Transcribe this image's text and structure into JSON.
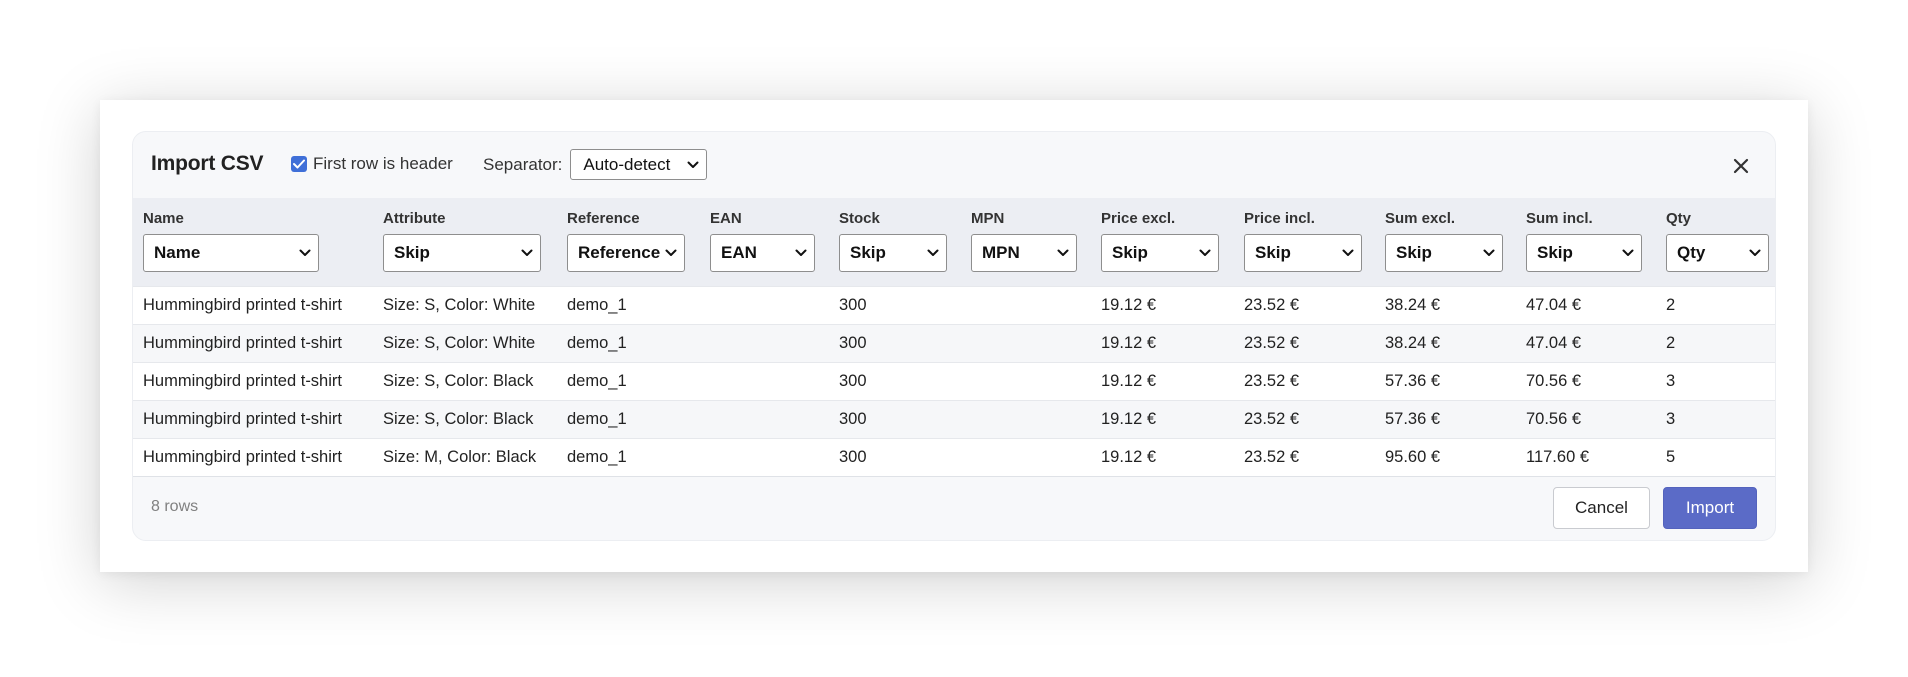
{
  "dialog": {
    "title": "Import CSV",
    "first_row_header_label": "First row is header",
    "first_row_header_checked": true,
    "separator_label": "Separator:",
    "separator_value": "Auto-detect",
    "close_icon": "close-icon"
  },
  "columns": [
    {
      "label": "Name",
      "mapping": "Name"
    },
    {
      "label": "Attribute",
      "mapping": "Skip"
    },
    {
      "label": "Reference",
      "mapping": "Reference"
    },
    {
      "label": "EAN",
      "mapping": "EAN"
    },
    {
      "label": "Stock",
      "mapping": "Skip"
    },
    {
      "label": "MPN",
      "mapping": "MPN"
    },
    {
      "label": "Price excl.",
      "mapping": "Skip"
    },
    {
      "label": "Price incl.",
      "mapping": "Skip"
    },
    {
      "label": "Sum excl.",
      "mapping": "Skip"
    },
    {
      "label": "Sum incl.",
      "mapping": "Skip"
    },
    {
      "label": "Qty",
      "mapping": "Qty"
    }
  ],
  "rows": [
    [
      "Hummingbird printed t-shirt",
      "Size: S, Color: White",
      "demo_1",
      "",
      "300",
      "",
      "19.12 €",
      "23.52 €",
      "38.24 €",
      "47.04 €",
      "2"
    ],
    [
      "Hummingbird printed t-shirt",
      "Size: S, Color: White",
      "demo_1",
      "",
      "300",
      "",
      "19.12 €",
      "23.52 €",
      "38.24 €",
      "47.04 €",
      "2"
    ],
    [
      "Hummingbird printed t-shirt",
      "Size: S, Color: Black",
      "demo_1",
      "",
      "300",
      "",
      "19.12 €",
      "23.52 €",
      "57.36 €",
      "70.56 €",
      "3"
    ],
    [
      "Hummingbird printed t-shirt",
      "Size: S, Color: Black",
      "demo_1",
      "",
      "300",
      "",
      "19.12 €",
      "23.52 €",
      "57.36 €",
      "70.56 €",
      "3"
    ],
    [
      "Hummingbird printed t-shirt",
      "Size: M, Color: Black",
      "demo_1",
      "",
      "300",
      "",
      "19.12 €",
      "23.52 €",
      "95.60 €",
      "117.60 €",
      "5"
    ]
  ],
  "footer": {
    "row_count": "8 rows",
    "cancel_label": "Cancel",
    "import_label": "Import"
  },
  "colors": {
    "accent": "#5b6bc7",
    "checkbox": "#3f6fd8"
  }
}
